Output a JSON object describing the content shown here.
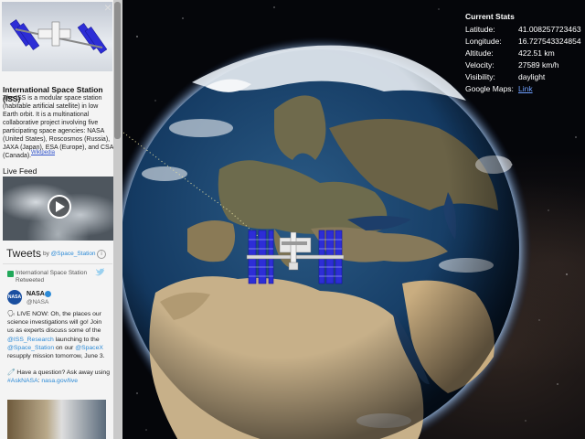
{
  "sidebar": {
    "close_label": "×",
    "iss_title": "International Space Station (ISS)",
    "iss_description": "The ISS is a modular space station (habitable artificial satellite) in low Earth orbit. It is a multinational collaborative project involving five participating space agencies: NASA (United States), Roscosmos (Russia), JAXA (Japan), ESA (Europe), and CSA (Canada).",
    "wiki_link": "Wikipedia",
    "live_feed_label": "Live Feed",
    "tweets": {
      "title": "Tweets",
      "by_prefix": "by ",
      "by_handle": "@Space_Station",
      "info": "i",
      "retweet_note": "International Space Station Retweeted",
      "author_name": "NASA",
      "author_avatar": "NASA",
      "author_handle": "@NASA",
      "body_parts": [
        "🗣 LIVE NOW: Oh, the places our science investigations will go! Join us as experts discuss some of the ",
        "@ISS_Research",
        " launching to the ",
        "@Space_Station",
        " on our ",
        "@SpaceX",
        " resupply mission tomorrow, June 3."
      ],
      "body2_parts": [
        "🧷 Have a question? Ask away using ",
        "#AskNASA",
        ": ",
        "nasa.gov/live"
      ]
    }
  },
  "stats": {
    "title": "Current Stats",
    "rows": [
      {
        "label": "Latitude:",
        "value": "41.008257723463"
      },
      {
        "label": "Longitude:",
        "value": "16.727543324854"
      },
      {
        "label": "Altitude:",
        "value": "422.51 km"
      },
      {
        "label": "Velocity:",
        "value": "27589 km/h"
      },
      {
        "label": "Visibility:",
        "value": "daylight"
      },
      {
        "label": "Google Maps:",
        "value": "Link"
      }
    ]
  },
  "icons": {
    "close": "close-icon",
    "play": "play-icon",
    "retweet": "retweet-icon",
    "twitter": "twitter-bird-icon",
    "verified": "verified-badge-icon",
    "info": "info-icon"
  },
  "colors": {
    "link": "#2c8ad6",
    "stats_link": "#6fa0ff",
    "solar_panel": "#2d2dd6"
  }
}
